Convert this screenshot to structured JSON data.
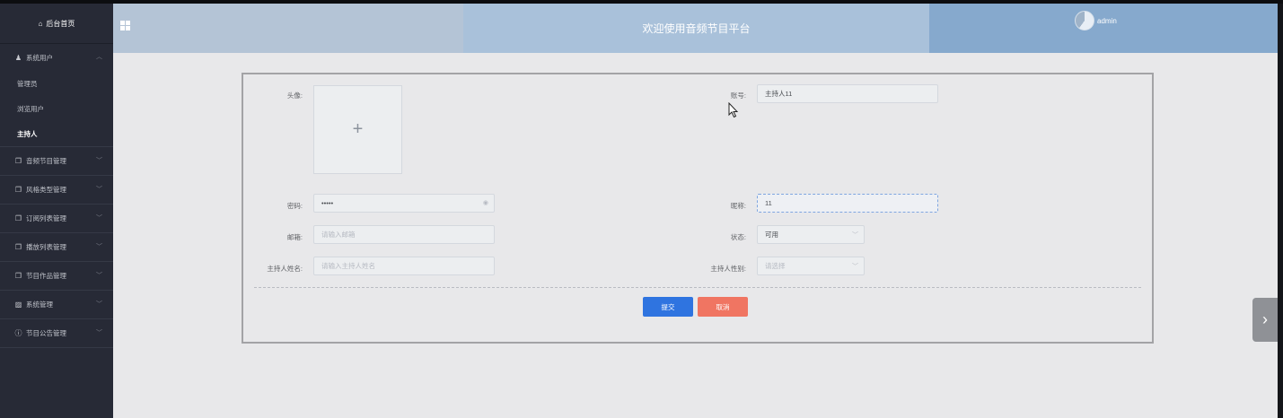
{
  "sidebar": {
    "home": "后台首页",
    "group": {
      "label": "系统用户",
      "items": [
        "管理员",
        "浏览用户",
        "主持人"
      ]
    },
    "menu": [
      {
        "label": "音频节目管理",
        "icon": "doc-icon"
      },
      {
        "label": "风格类型管理",
        "icon": "doc-icon"
      },
      {
        "label": "订阅列表管理",
        "icon": "doc-icon"
      },
      {
        "label": "播放列表管理",
        "icon": "doc-icon"
      },
      {
        "label": "节目作品管理",
        "icon": "doc-icon"
      },
      {
        "label": "系统管理",
        "icon": "picture-icon"
      },
      {
        "label": "节目公告管理",
        "icon": "info-icon"
      }
    ]
  },
  "header": {
    "title": "欢迎使用音频节目平台",
    "username": "admin"
  },
  "form": {
    "avatar_label": "头像:",
    "avatar_plus": "+",
    "account_label": "账号:",
    "account_value": "主持人11",
    "password_label": "密码:",
    "password_value": "•••••",
    "nickname_label": "昵称:",
    "nickname_value": "11",
    "email_label": "邮箱:",
    "email_placeholder": "请输入邮箱",
    "status_label": "状态:",
    "status_value": "可用",
    "name_label": "主持人姓名:",
    "name_placeholder": "请输入主持人姓名",
    "gender_label": "主持人性别:",
    "gender_placeholder": "请选择",
    "submit": "提交",
    "cancel": "取消"
  },
  "colors": {
    "sidebar_bg": "#272a36",
    "primary": "#2f74e0",
    "danger": "#f07562"
  }
}
